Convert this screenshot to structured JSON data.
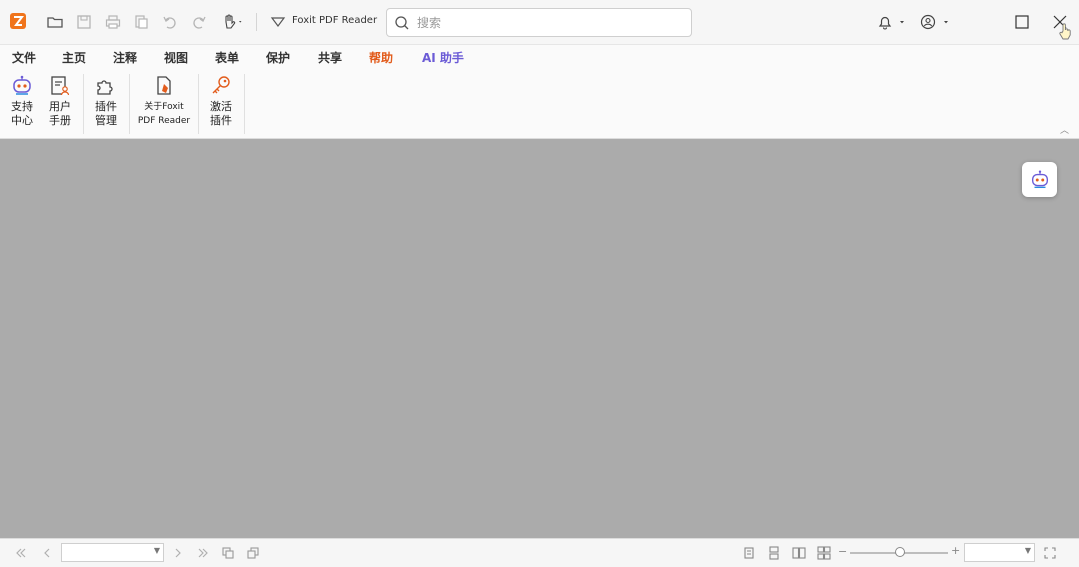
{
  "titlebar": {
    "app_title": "Foxit PDF Reader",
    "search_placeholder": "搜索",
    "icons": [
      "app-logo-icon",
      "open-folder-icon",
      "save-icon",
      "print-icon",
      "export-icon",
      "undo-icon",
      "redo-icon",
      "hand-tool-icon",
      "dropdown-filter-icon",
      "search-icon",
      "bell-icon",
      "account-icon",
      "maximize-icon",
      "close-icon"
    ]
  },
  "menu": {
    "tabs": [
      {
        "label": "文件"
      },
      {
        "label": "主页"
      },
      {
        "label": "注释"
      },
      {
        "label": "视图"
      },
      {
        "label": "表单"
      },
      {
        "label": "保护"
      },
      {
        "label": "共享"
      },
      {
        "label": "帮助"
      },
      {
        "label": "AI 助手"
      }
    ],
    "active_tab": "帮助"
  },
  "ribbon": {
    "buttons": [
      {
        "label": "支持\n中心",
        "icon": "robot-support-icon"
      },
      {
        "label": "用户\n手册",
        "icon": "user-manual-icon"
      },
      {
        "label": "插件\n管理",
        "icon": "plugin-icon"
      },
      {
        "label": "关于Foxit\nPDF Reader",
        "icon": "about-icon"
      },
      {
        "label": "激活\n插件",
        "icon": "key-icon"
      }
    ]
  },
  "statusbar": {
    "page_value": "",
    "zoom_value": "",
    "icons": [
      "first-page-icon",
      "prev-page-icon",
      "next-page-icon",
      "last-page-icon",
      "rotate-left-icon",
      "rotate-right-icon",
      "single-page-icon",
      "continuous-icon",
      "facing-icon",
      "continuous-facing-icon",
      "fullscreen-icon"
    ]
  },
  "colors": {
    "accent": "#e25c1c",
    "ai_tab": "#6b5bd6",
    "workarea": "#ababab",
    "logo": "#f0741c"
  }
}
